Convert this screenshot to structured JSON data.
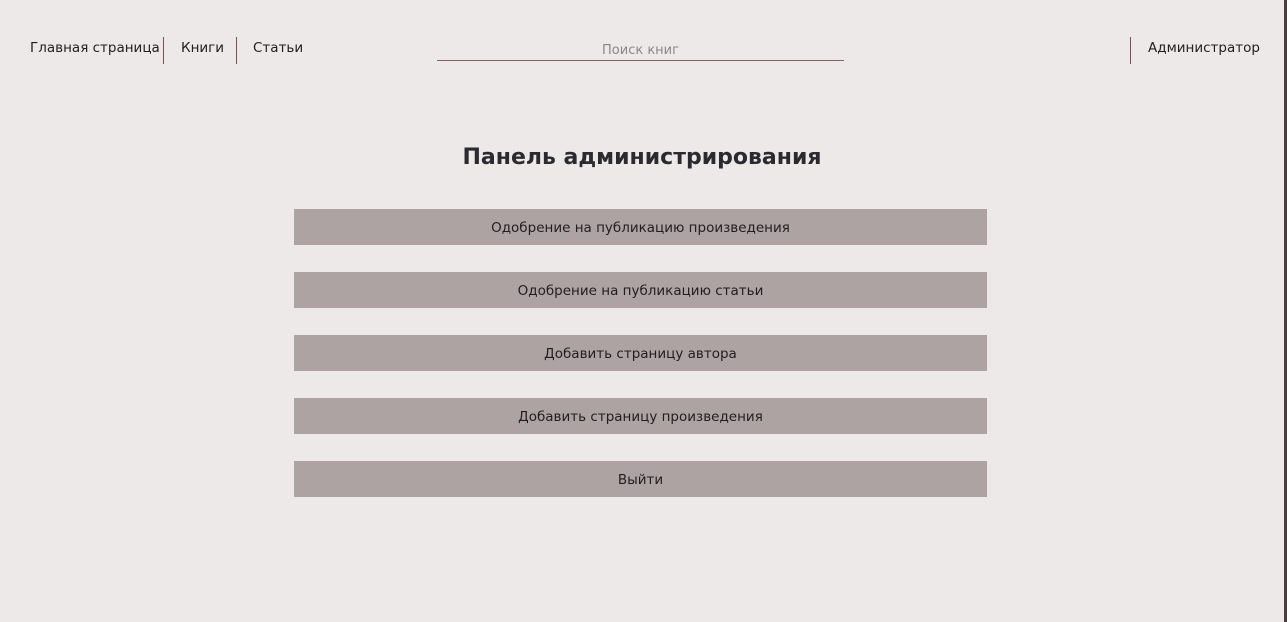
{
  "nav": {
    "home": "Главная страница",
    "books": "Книги",
    "articles": "Статьи",
    "user": "Администратор"
  },
  "search": {
    "placeholder": "Поиск книг",
    "value": ""
  },
  "main": {
    "title": "Панель администрирования",
    "buttons": [
      {
        "label": "Одобрение на публикацию произведения"
      },
      {
        "label": "Одобрение на публикацию статьи"
      },
      {
        "label": "Добавить страницу автора"
      },
      {
        "label": "Добавить страницу произведения"
      },
      {
        "label": "Выйти"
      }
    ]
  },
  "colors": {
    "background": "#ede9e8",
    "button": "#ada3a2",
    "divider": "#7d4f4f",
    "text": "#1f1f1f"
  }
}
